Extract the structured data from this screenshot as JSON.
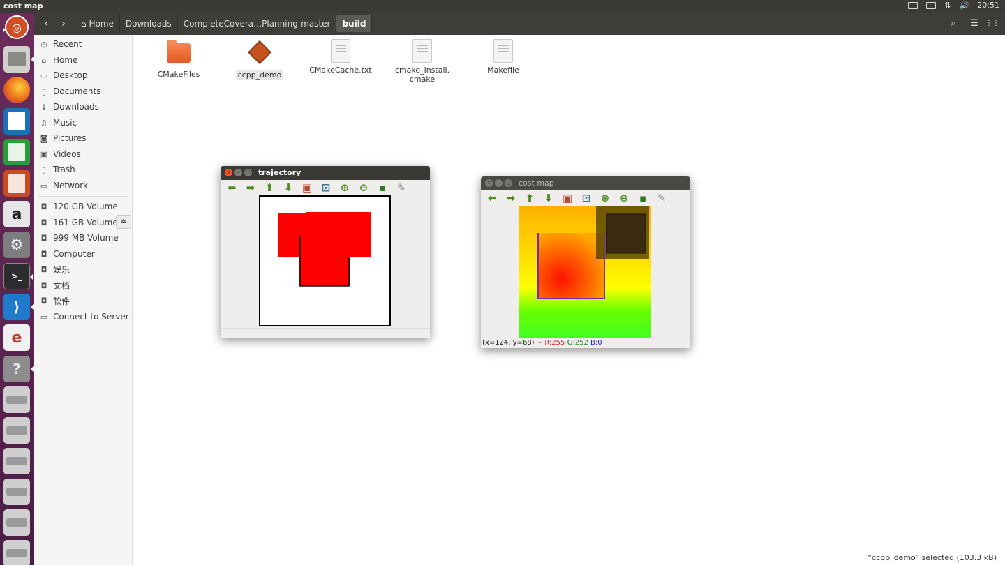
{
  "top_panel": {
    "window_title": "cost map",
    "indicators": [
      "keyboard-icon",
      "battery-icon",
      "network-icon",
      "volume-icon"
    ],
    "clock": "20:51"
  },
  "launcher": {
    "items": [
      {
        "name": "ubuntu-dash-icon",
        "color": "#d24f25"
      },
      {
        "name": "files-icon",
        "color": "#8a8a84"
      },
      {
        "name": "firefox-icon",
        "color": "#e8631a"
      },
      {
        "name": "writer-icon",
        "color": "#1e6fb7"
      },
      {
        "name": "calc-icon",
        "color": "#2c9b3a"
      },
      {
        "name": "impress-icon",
        "color": "#c94c20"
      },
      {
        "name": "amazon-icon",
        "color": "#e6e6e6"
      },
      {
        "name": "settings-icon",
        "color": "#7d7d7d"
      },
      {
        "name": "terminal-icon",
        "color": "#2d2d2d"
      },
      {
        "name": "vscode-icon",
        "color": "#1f7acc"
      },
      {
        "name": "editor-icon",
        "color": "#c33a2d"
      },
      {
        "name": "help-icon",
        "color": "#8d8d8d"
      },
      {
        "name": "drive-icon",
        "color": "#b9b9b9"
      },
      {
        "name": "drive-icon",
        "color": "#b9b9b9"
      },
      {
        "name": "drive-icon",
        "color": "#b9b9b9"
      },
      {
        "name": "drive-icon",
        "color": "#b9b9b9"
      },
      {
        "name": "drive-icon",
        "color": "#b9b9b9"
      },
      {
        "name": "drive-icon",
        "color": "#b9b9b9"
      }
    ],
    "glyphs": {
      "amazon": "a",
      "terminal": ">_",
      "help": "?"
    }
  },
  "header": {
    "back": "‹",
    "forward": "›",
    "breadcrumbs": [
      "Home",
      "Downloads",
      "CompleteCovera…Planning-master",
      "build"
    ],
    "search_icon": "🔍",
    "list_icon": "☰",
    "grid_icon": "⋮⋮"
  },
  "sidebar": {
    "items": [
      {
        "label": "Recent",
        "icon": "◷"
      },
      {
        "label": "Home",
        "icon": "⌂"
      },
      {
        "label": "Desktop",
        "icon": "▭"
      },
      {
        "label": "Documents",
        "icon": "▯"
      },
      {
        "label": "Downloads",
        "icon": "↓"
      },
      {
        "label": "Music",
        "icon": "♫"
      },
      {
        "label": "Pictures",
        "icon": "◙"
      },
      {
        "label": "Videos",
        "icon": "▣"
      },
      {
        "label": "Trash",
        "icon": "▯"
      },
      {
        "label": "Network",
        "icon": "▭"
      },
      {
        "label": "120 GB Volume",
        "icon": "◘"
      },
      {
        "label": "161 GB Volume",
        "icon": "◘"
      },
      {
        "label": "999 MB Volume",
        "icon": "◘"
      },
      {
        "label": "Computer",
        "icon": "◘"
      },
      {
        "label": "娱乐",
        "icon": "◘"
      },
      {
        "label": "文档",
        "icon": "◘"
      },
      {
        "label": "软件",
        "icon": "◘"
      },
      {
        "label": "Connect to Server",
        "icon": "▭"
      }
    ],
    "eject": "⏏"
  },
  "files": [
    {
      "name": "CMakeFiles",
      "kind": "folder"
    },
    {
      "name": "ccpp_demo",
      "kind": "executable",
      "selected": true
    },
    {
      "name": "CMakeCache.txt",
      "kind": "document"
    },
    {
      "name": "cmake_install.\ncmake",
      "kind": "document"
    },
    {
      "name": "Makefile",
      "kind": "document"
    }
  ],
  "trajectory_window": {
    "title": "trajectory",
    "toolbar": [
      "⬅",
      "➡",
      "⬆",
      "⬇",
      "▣",
      "⊡",
      "⊕",
      "⊖",
      "▪",
      "✎"
    ]
  },
  "costmap_window": {
    "title": "cost map",
    "toolbar": [
      "⬅",
      "➡",
      "⬆",
      "⬇",
      "▣",
      "⊡",
      "⊕",
      "⊖",
      "▪",
      "✎"
    ],
    "status": {
      "coords": "(x=124, y=68) ~ ",
      "r": "R:255",
      "g": "G:252",
      "b": "B:0"
    }
  },
  "status_bar": "“ccpp_demo” selected  (103.3 kB)"
}
